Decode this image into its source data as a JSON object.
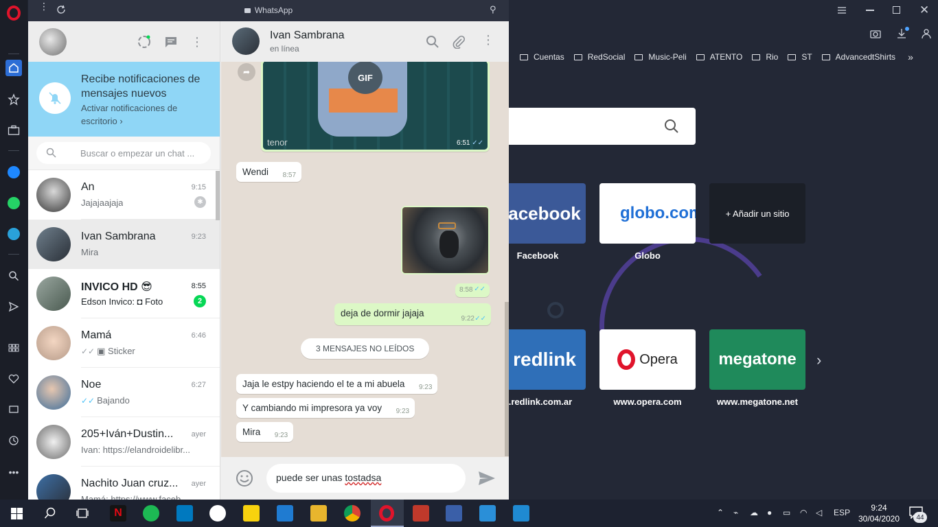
{
  "app": {
    "window_title": "WhatsApp"
  },
  "left": {
    "notification": {
      "title": "Recibe notificaciones de mensajes nuevos",
      "subtitle": "Activar notificaciones de escritorio"
    },
    "search_placeholder": "Buscar o empezar un chat ...",
    "chats": [
      {
        "name": "An",
        "time": "9:15",
        "message": "Jajajaajaja"
      },
      {
        "name": "Ivan  Sambrana",
        "time": "9:23",
        "message": "Mira"
      },
      {
        "name": "INVICO HD 😎",
        "time": "8:55",
        "message_sender": "Edson Invico:",
        "message": "Foto",
        "unread": "2"
      },
      {
        "name": "Mamá",
        "time": "6:46",
        "message": "Sticker"
      },
      {
        "name": "Noe",
        "time": "6:27",
        "message": "Bajando"
      },
      {
        "name": "205+Iván+Dustin...",
        "time": "ayer",
        "message": "Ivan: https://elandroidelibr..."
      },
      {
        "name": "Nachito Juan cruz...",
        "time": "ayer",
        "message": "Mamá: https://www.faceb..."
      }
    ]
  },
  "conversation": {
    "contact_name": "Ivan  Sambrana",
    "status": "en línea",
    "gif_badge": "GIF",
    "gif_source": "tenor",
    "gif_time": "6:51",
    "image_time": "8:58",
    "unread_divider": "3 MENSAJES NO LEÍDOS",
    "messages": [
      {
        "text": "Wendi",
        "time": "8:57"
      },
      {
        "text": "deja de dormir jajaja",
        "time": "9:22"
      },
      {
        "text": "Jaja le estpy haciendo el te a mi abuela",
        "time": "9:23"
      },
      {
        "text": "Y cambiando mi impresora ya voy",
        "time": "9:23"
      },
      {
        "text": "Mira",
        "time": "9:23"
      }
    ],
    "composer_text_1": "puede ser unas ",
    "composer_text_2": "tostadsa"
  },
  "browser": {
    "bookmarks": [
      "Cuentas",
      "RedSocial",
      "Music-Peli",
      "ATENTO",
      "Rio",
      "ST",
      "AdvancedtShirts"
    ],
    "tiles": [
      {
        "logo": "acebook",
        "label": "Facebook"
      },
      {
        "logo": "globo.com",
        "label": "Globo"
      },
      {
        "logo": "+ Añadir un sitio",
        "label": ""
      },
      {
        "logo": "redlink",
        "label": "b.redlink.com.ar"
      },
      {
        "logo": "Opera",
        "label": "www.opera.com"
      },
      {
        "logo": "megatone",
        "label": "www.megatone.net"
      }
    ]
  },
  "taskbar": {
    "lang": "ESP",
    "time": "9:24",
    "date": "30/04/2020",
    "notifications": "44"
  },
  "colors": {
    "whatsapp_green": "#06d755",
    "outgoing_bubble": "#dcf8c6",
    "notif_banner": "#8fd6f6",
    "opera_red": "#e0142b"
  }
}
